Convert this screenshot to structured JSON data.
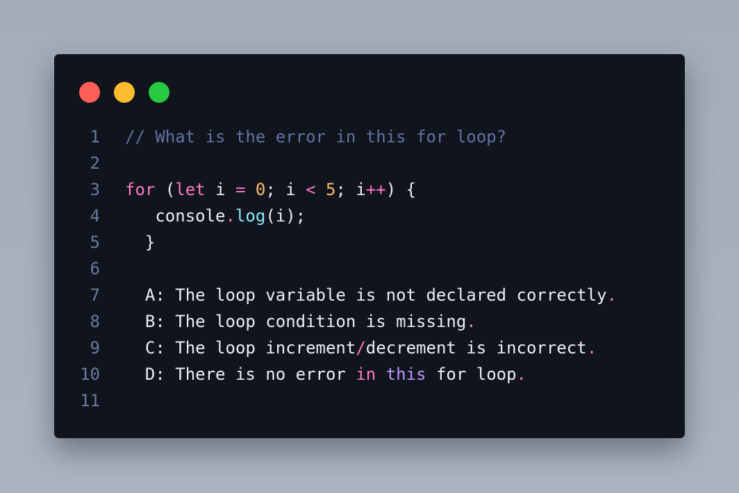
{
  "window": {
    "controls": [
      "close",
      "minimize",
      "maximize"
    ],
    "colors": {
      "close": "#ff5f57",
      "minimize": "#febc2e",
      "maximize": "#28c840"
    }
  },
  "code": {
    "line_numbers": [
      "1",
      "2",
      "3",
      "4",
      "5",
      "6",
      "7",
      "8",
      "9",
      "10",
      "11"
    ],
    "line1": {
      "comment": "// What is the error in this for loop?"
    },
    "line3": {
      "for_kw": "for",
      "open": " (",
      "let_kw": "let",
      "var_i": " i ",
      "eq": "=",
      "sp1": " ",
      "zero": "0",
      "semi1": "; i ",
      "lt": "<",
      "sp2": " ",
      "five": "5",
      "semi2": "; i",
      "inc": "++",
      "close": ") {"
    },
    "line4": {
      "indent": "   ",
      "obj": "console",
      "dot": ".",
      "method": "log",
      "args": "(i);"
    },
    "line5": {
      "text": "  }"
    },
    "line7": {
      "text": "  A: The loop variable is not declared correctly",
      "dot": "."
    },
    "line8": {
      "text": "  B: The loop condition is missing",
      "dot": "."
    },
    "line9": {
      "pre": "  C: The loop increment",
      "slash": "/",
      "post": "decrement is incorrect",
      "dot": "."
    },
    "line10": {
      "pre": "  D: There is no error ",
      "in_kw": "in",
      "sp": " ",
      "this_kw": "this",
      "post": " for loop",
      "dot": "."
    }
  }
}
